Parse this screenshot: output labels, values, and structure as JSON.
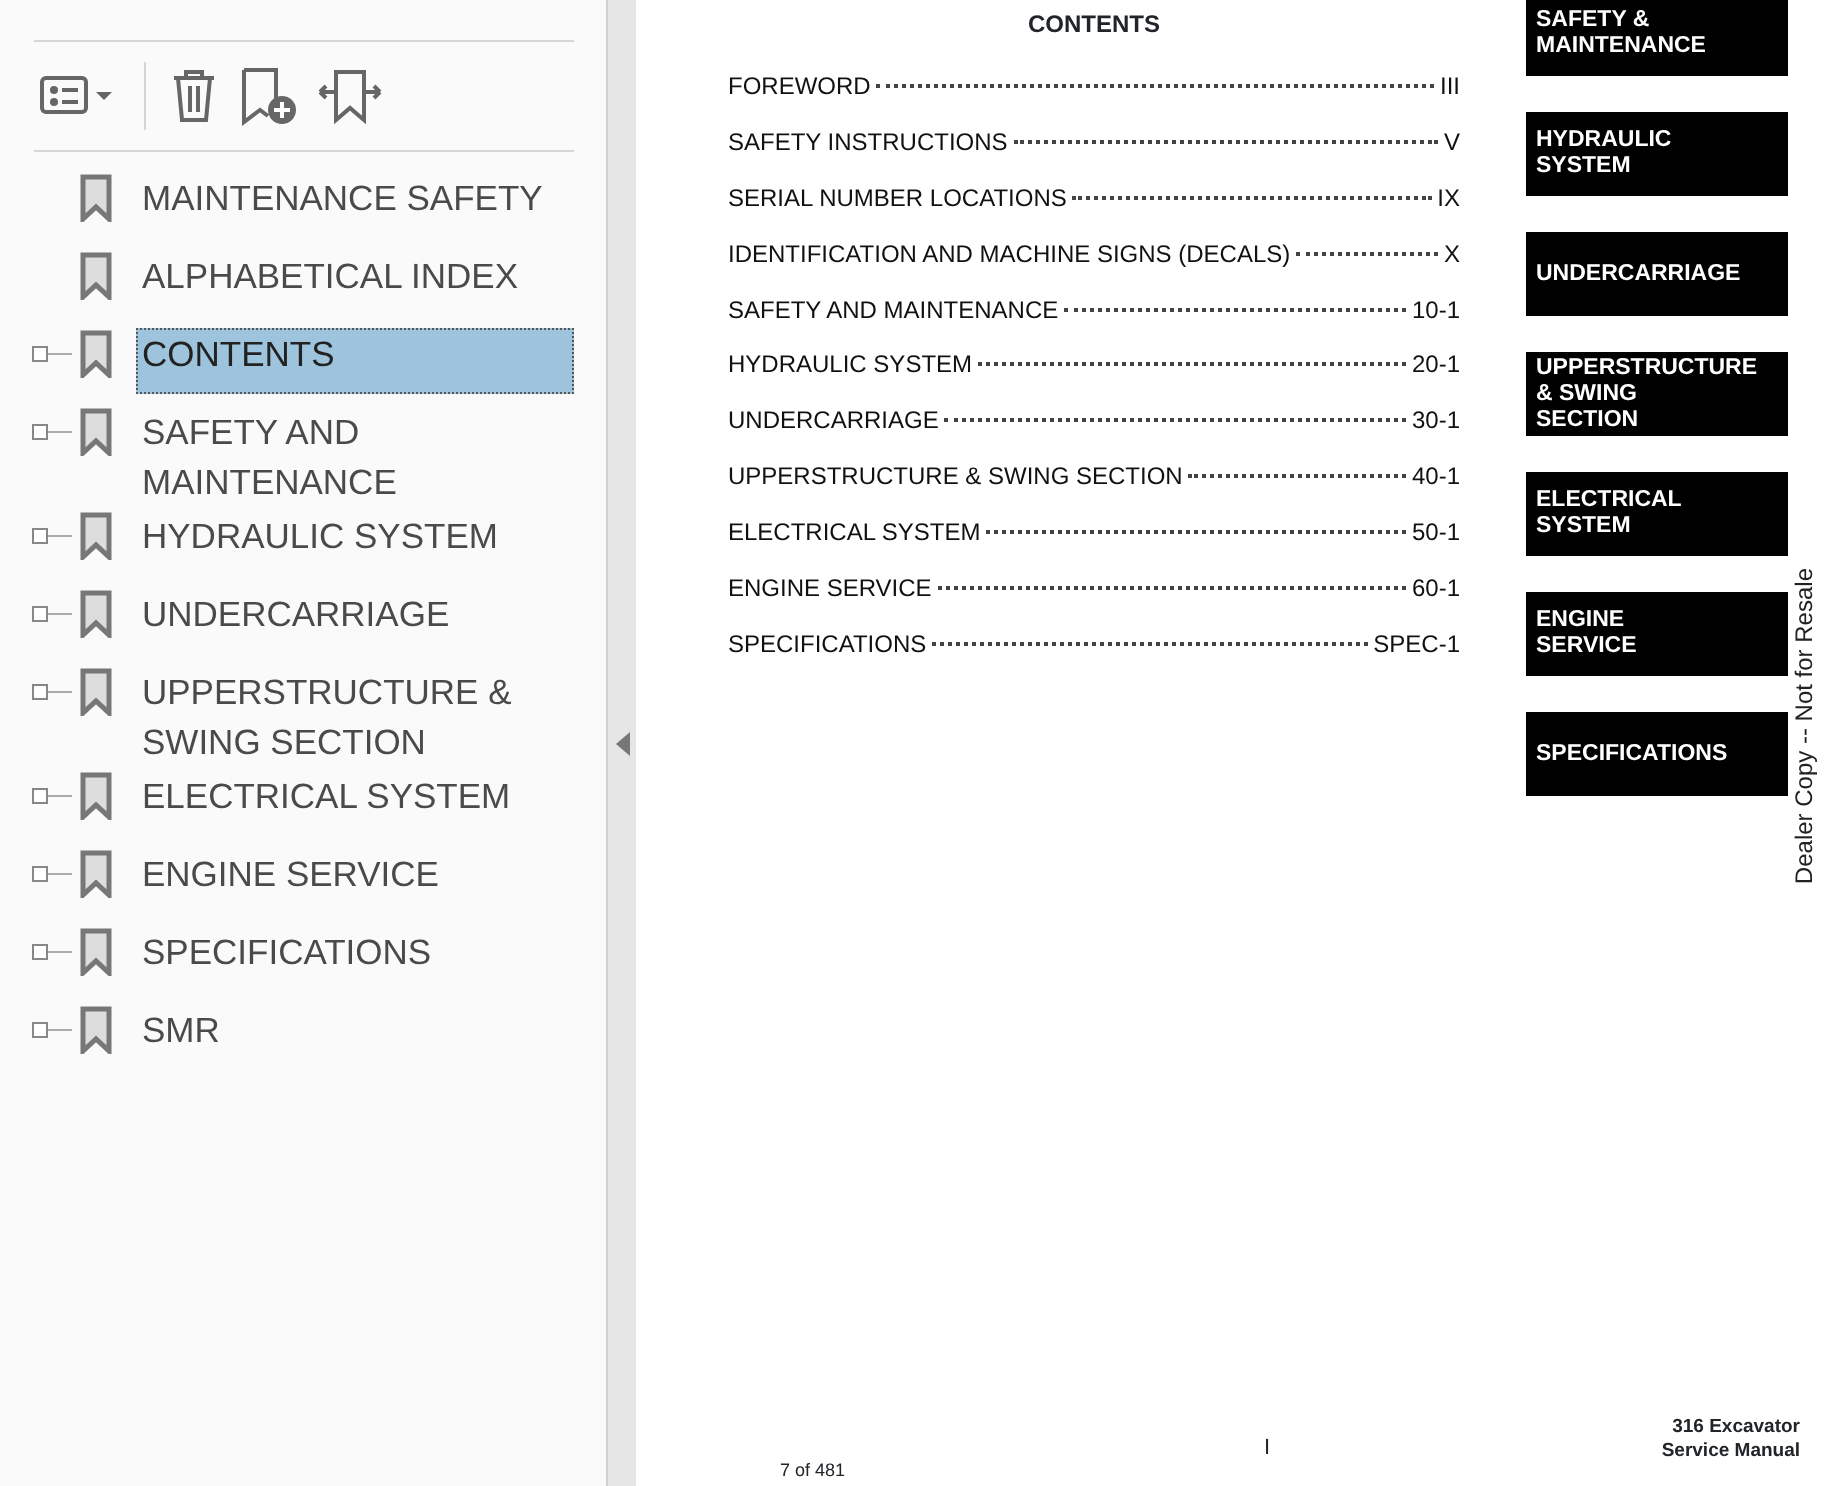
{
  "bookmarks": [
    {
      "label": "MAINTENANCE SAFETY",
      "kind": "leaf",
      "selected": false
    },
    {
      "label": "ALPHABETICAL INDEX",
      "kind": "leaf",
      "selected": false
    },
    {
      "label": "CONTENTS",
      "kind": "branch",
      "selected": true
    },
    {
      "label": "SAFETY AND MAINTENANCE",
      "kind": "branch",
      "selected": false
    },
    {
      "label": "HYDRAULIC SYSTEM",
      "kind": "branch",
      "selected": false
    },
    {
      "label": "UNDERCARRIAGE",
      "kind": "branch",
      "selected": false
    },
    {
      "label": "UPPERSTRUCTURE & SWING SECTION",
      "kind": "branch",
      "selected": false
    },
    {
      "label": "ELECTRICAL SYSTEM",
      "kind": "branch",
      "selected": false
    },
    {
      "label": "ENGINE SERVICE",
      "kind": "branch",
      "selected": false
    },
    {
      "label": "SPECIFICATIONS",
      "kind": "branch",
      "selected": false
    },
    {
      "label": "SMR",
      "kind": "branch",
      "selected": false
    }
  ],
  "page": {
    "title": "CONTENTS",
    "toc": [
      {
        "entry": "FOREWORD",
        "page": "III"
      },
      {
        "entry": "SAFETY INSTRUCTIONS",
        "page": "V"
      },
      {
        "entry": "SERIAL NUMBER LOCATIONS",
        "page": "IX"
      },
      {
        "entry": "IDENTIFICATION AND MACHINE SIGNS (DECALS)",
        "page": "X"
      },
      {
        "entry": "SAFETY AND MAINTENANCE",
        "page": "10-1"
      },
      {
        "entry": "HYDRAULIC SYSTEM",
        "page": "20-1"
      },
      {
        "entry": "UNDERCARRIAGE",
        "page": "30-1"
      },
      {
        "entry": "UPPERSTRUCTURE & SWING SECTION",
        "page": "40-1"
      },
      {
        "entry": "ELECTRICAL SYSTEM",
        "page": "50-1"
      },
      {
        "entry": "ENGINE SERVICE",
        "page": "60-1"
      },
      {
        "entry": "SPECIFICATIONS",
        "page": "SPEC-1"
      }
    ],
    "section_tabs": [
      "SAFETY &\nMAINTENANCE",
      "HYDRAULIC\nSYSTEM",
      "UNDERCARRIAGE",
      "UPPERSTRUCTURE\n& SWING\nSECTION",
      "ELECTRICAL\nSYSTEM",
      "ENGINE\nSERVICE",
      "SPECIFICATIONS"
    ],
    "side_note": "Dealer Copy -- Not for Resale",
    "page_number": "I",
    "page_counter": "7 of 481",
    "footer": [
      "316 Excavator",
      "Service Manual"
    ]
  }
}
